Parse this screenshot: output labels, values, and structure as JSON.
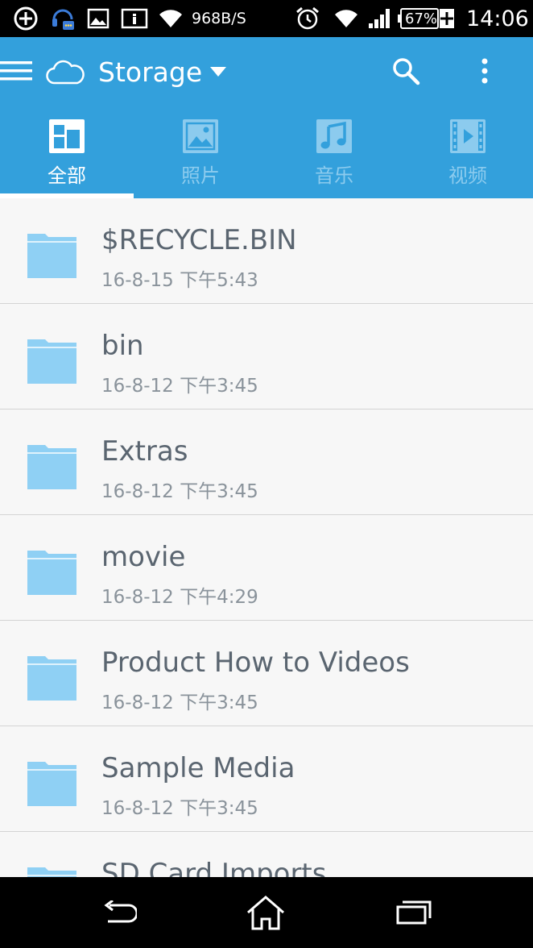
{
  "status_bar": {
    "net_speed": "968B/S",
    "battery": "67%",
    "time": "14:06",
    "icons": [
      "add-circle-icon",
      "headset-chat-icon",
      "image-icon",
      "info-card-icon",
      "wifi-icon",
      "alarm-icon",
      "wifi-icon",
      "signal-icon",
      "battery-charging-icon"
    ]
  },
  "app_bar": {
    "title": "Storage",
    "icons": [
      "menu-icon",
      "cloud-icon",
      "dropdown-arrow-icon",
      "search-icon",
      "more-vert-icon"
    ],
    "accent_color": "#33a0dc"
  },
  "tabs": [
    {
      "label": "全部",
      "icon": "grid-icon",
      "active": true
    },
    {
      "label": "照片",
      "icon": "photo-icon",
      "active": false
    },
    {
      "label": "音乐",
      "icon": "music-icon",
      "active": false
    },
    {
      "label": "视频",
      "icon": "video-icon",
      "active": false
    }
  ],
  "files": [
    {
      "name": "$RECYCLE.BIN",
      "date": "16-8-15 下午5:43"
    },
    {
      "name": "bin",
      "date": "16-8-12 下午3:45"
    },
    {
      "name": "Extras",
      "date": "16-8-12 下午3:45"
    },
    {
      "name": "movie",
      "date": "16-8-12 下午4:29"
    },
    {
      "name": "Product How to Videos",
      "date": "16-8-12 下午3:45"
    },
    {
      "name": "Sample Media",
      "date": "16-8-12 下午3:45"
    },
    {
      "name": "SD Card Imports",
      "date": ""
    }
  ],
  "nav_bar": {
    "icons": [
      "back-icon",
      "home-icon",
      "recents-icon"
    ]
  }
}
